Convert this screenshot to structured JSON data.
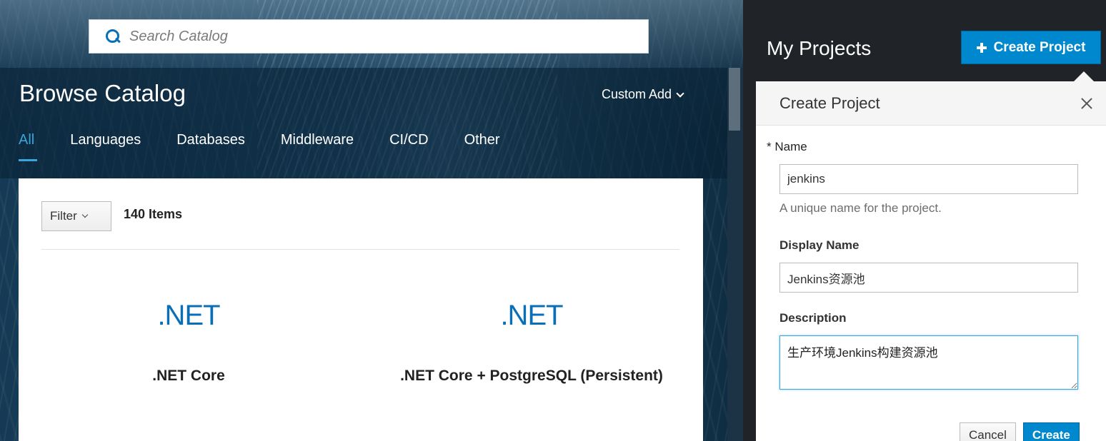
{
  "catalog": {
    "search": {
      "placeholder": "Search Catalog"
    },
    "title": "Browse Catalog",
    "custom_add": "Custom Add",
    "tabs": [
      {
        "label": "All",
        "active": true
      },
      {
        "label": "Languages"
      },
      {
        "label": "Databases"
      },
      {
        "label": "Middleware"
      },
      {
        "label": "CI/CD"
      },
      {
        "label": "Other"
      }
    ],
    "filter_label": "Filter",
    "items_count": "140 Items",
    "tiles": [
      {
        "logo": ".NET",
        "name": ".NET Core"
      },
      {
        "logo": ".NET",
        "name": ".NET Core + PostgreSQL (Persistent)"
      }
    ]
  },
  "projects": {
    "title": "My Projects",
    "create_button": "Create Project",
    "popover": {
      "title": "Create Project",
      "name_label": "* Name",
      "name_value": "jenkins",
      "name_help": "A unique name for the project.",
      "display_name_label": "Display Name",
      "display_name_value": "Jenkins资源池",
      "description_label": "Description",
      "description_value": "生产环境Jenkins构建资源池",
      "cancel_label": "Cancel",
      "create_label": "Create"
    }
  },
  "colors": {
    "accent": "#0088ce",
    "active_tab": "#39a5dc",
    "dark_panel": "#202327",
    "net_logo": "#0a6fb7"
  },
  "icons": [
    "search-icon",
    "chevron-down-icon",
    "plus-icon",
    "close-icon"
  ]
}
